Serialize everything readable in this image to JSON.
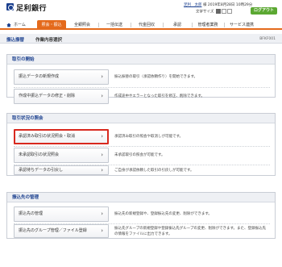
{
  "header": {
    "bank_name": "足利銀行",
    "user_name": "足利　太郎",
    "user_suffix": "様",
    "last_login": "2019年8月28日 10時29分",
    "text_size_label": "文字サイズ",
    "logout_label": "ログアウト"
  },
  "nav": {
    "items": [
      {
        "label": "ホーム"
      },
      {
        "label": "照会・振込"
      },
      {
        "label": "全銀照会"
      },
      {
        "label": "一括伝送"
      },
      {
        "label": "代金回収"
      },
      {
        "label": "承認"
      },
      {
        "label": "管理者業務"
      },
      {
        "label": "サービス連携"
      }
    ]
  },
  "page": {
    "title": "振込振替",
    "subtitle": "作業内容選択",
    "screen_id": "BFKF001"
  },
  "sections": [
    {
      "heading": "取引の開始",
      "rows": [
        {
          "button": "振込データの新規作成",
          "desc": "振込振替の取引（承認依頼作り）を開始できます。"
        },
        {
          "button": "作成中振込データの修正・削除",
          "desc": "作成途中やエラーとなった取引を修正、削除できます。"
        }
      ]
    },
    {
      "heading": "取引状況の照会",
      "rows": [
        {
          "button": "承認済み取引の状況照会・取消",
          "desc": "承認済み取引の照会や取消しが可能です。"
        },
        {
          "button": "未承認取引の状況照会",
          "desc": "未承認取引の照会が可能です。"
        },
        {
          "button": "承認待ちデータの引戻し",
          "desc": "ご自身が承認依頼した取引の引戻しが可能です。"
        }
      ]
    },
    {
      "heading": "振込先の管理",
      "rows": [
        {
          "button": "振込先の管理",
          "desc": "振込先の新規登録や、登録振込先の変更、削除ができます。"
        },
        {
          "button": "振込先のグループ管理／ファイル登録",
          "desc": "振込先グループの新規登録や登録振込先グループの変更、削除ができます。また、登録振込先の情報をファイルに出力できます。"
        }
      ]
    }
  ]
}
